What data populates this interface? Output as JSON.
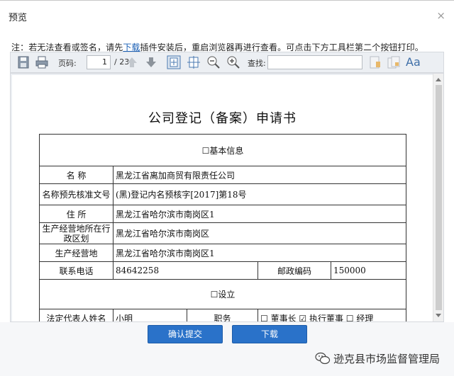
{
  "window": {
    "title": "预览",
    "close_glyph": "×"
  },
  "notice": {
    "prefix": "注：若无法查看或签名，请先",
    "link": "下载",
    "suffix": "插件安装后，重启浏览器再进行查看。可点击下方工具栏第二个按钮打印。"
  },
  "toolbar": {
    "page_label": "页码:",
    "page_value": "1",
    "page_total": "/ 23",
    "search_label": "查找:",
    "search_value": "",
    "icons": [
      "save-icon",
      "print-icon",
      "arrow-up-icon",
      "arrow-down-icon",
      "fit-page-icon",
      "fit-width-icon",
      "zoom-out-icon",
      "zoom-in-icon",
      "highlight-icon",
      "copy-icon",
      "font-size-icon"
    ],
    "font_icon_text": "Aa"
  },
  "document": {
    "title": "公司登记（备案）申请书",
    "basic_info": "☐基本信息",
    "name_label": "名  称",
    "name_value": "黑龙江省离加商贸有限责任公司",
    "approval_label": "名称预先核准文号",
    "approval_value": "(黑)登记内名预核字[2017]第18号",
    "address_label": "住  所",
    "address_value": "黑龙江省哈尔滨市南岗区1",
    "region_label": "生产经营地所在行政区划",
    "region_value": "黑龙江省哈尔滨市南岗区",
    "site_label": "生产经营地",
    "site_value": "黑龙江省哈尔滨市南岗区1",
    "phone_label": "联系电话",
    "phone_value": "84642258",
    "zip_label": "邮政编码",
    "zip_value": "150000",
    "setup": "☐设立",
    "legal_label": "法定代表人姓名",
    "legal_value": "小明",
    "position_label": "职务",
    "position_options": "☐ 董事长 ☑ 执行董事 ☐ 经理"
  },
  "footer": {
    "confirm_label": "确认提交",
    "download_label": "下载"
  },
  "watermark": {
    "text": "逊克县市场监督管理局"
  },
  "colors": {
    "button": "#2a72c9",
    "link": "#1a5fb4",
    "toolbar": "#eceff3"
  }
}
